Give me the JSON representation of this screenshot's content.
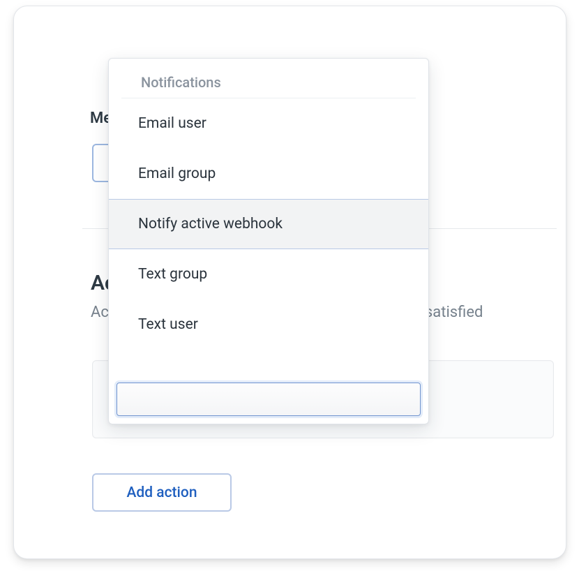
{
  "background": {
    "label_prefix": "Me",
    "section_title_prefix": "Ac",
    "section_desc_prefix": "Ac",
    "section_desc_suffix": "e satisfied",
    "add_action_label": "Add action"
  },
  "dropdown": {
    "header": "Notifications",
    "items": [
      {
        "label": "Email user",
        "selected": false
      },
      {
        "label": "Email group",
        "selected": false
      },
      {
        "label": "Notify active webhook",
        "selected": true
      },
      {
        "label": "Text group",
        "selected": false
      },
      {
        "label": "Text user",
        "selected": false
      }
    ],
    "input_value": ""
  }
}
